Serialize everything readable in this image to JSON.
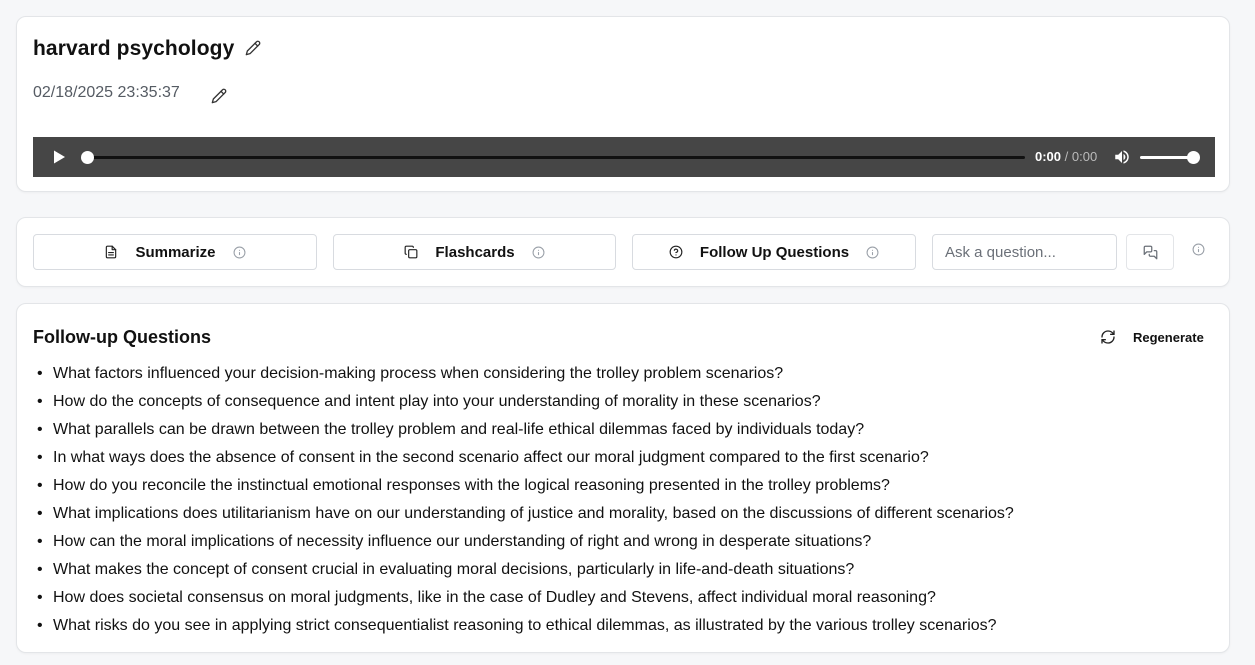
{
  "header": {
    "title": "harvard psychology",
    "date": "02/18/2025 23:35:37"
  },
  "player": {
    "current_time": "0:00",
    "separator": " / ",
    "duration": "0:00",
    "progress": 0,
    "volume": 1.0
  },
  "actions": {
    "summarize_label": "Summarize",
    "flashcards_label": "Flashcards",
    "followup_label": "Follow Up Questions",
    "ask_placeholder": "Ask a question..."
  },
  "followup": {
    "title": "Follow-up Questions",
    "regenerate_label": "Regenerate",
    "questions": [
      "What factors influenced your decision-making process when considering the trolley problem scenarios?",
      "How do the concepts of consequence and intent play into your understanding of morality in these scenarios?",
      "What parallels can be drawn between the trolley problem and real-life ethical dilemmas faced by individuals today?",
      "In what ways does the absence of consent in the second scenario affect our moral judgment compared to the first scenario?",
      "How do you reconcile the instinctual emotional responses with the logical reasoning presented in the trolley problems?",
      "What implications does utilitarianism have on our understanding of justice and morality, based on the discussions of different scenarios?",
      "How can the moral implications of necessity influence our understanding of right and wrong in desperate situations?",
      "What makes the concept of consent crucial in evaluating moral decisions, particularly in life-and-death situations?",
      "How does societal consensus on moral judgments, like in the case of Dudley and Stevens, affect individual moral reasoning?",
      "What risks do you see in applying strict consequentialist reasoning to ethical dilemmas, as illustrated by the various trolley scenarios?"
    ]
  },
  "icons": {
    "edit": "pencil-icon",
    "play": "play-icon",
    "volume": "volume-icon",
    "summarize": "document-icon",
    "flashcards": "copy-icon",
    "followup": "help-circle-icon",
    "info": "info-icon",
    "send": "message-icon",
    "regenerate": "refresh-icon"
  },
  "colors": {
    "player_bg": "#464646",
    "card_border": "#e3e5e8",
    "page_bg": "#f6f7f9"
  }
}
